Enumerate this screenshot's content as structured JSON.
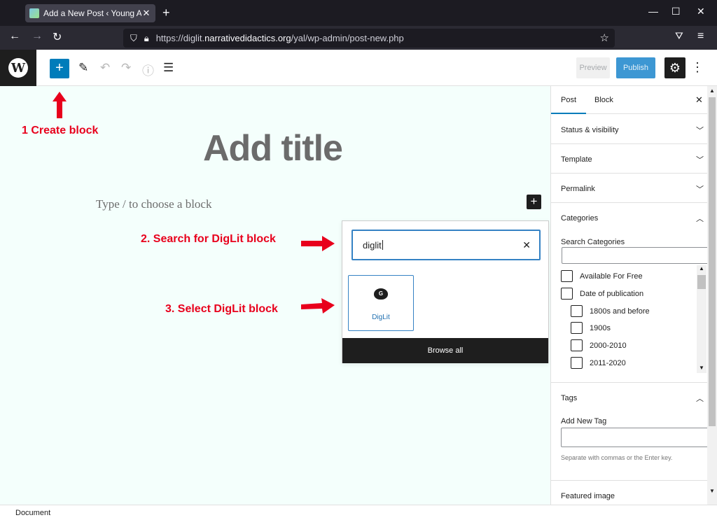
{
  "browser": {
    "tab_title": "Add a New Post ‹ Young Adult L",
    "url_prefix": "https://diglit.",
    "url_host": "narrativedidactics.org",
    "url_path": "/yal/wp-admin/post-new.php"
  },
  "toolbar": {
    "preview_label": "Preview",
    "publish_label": "Publish"
  },
  "annotations": {
    "step1": "1 Create block",
    "step2": "2. Search for DigLit block",
    "step3": "3. Select DigLit block",
    "color": "#e8001c"
  },
  "editor": {
    "title_placeholder": "Add title",
    "block_placeholder": "Type / to choose a block",
    "canvas_bg": "#f4fffc"
  },
  "inserter": {
    "search_value": "diglit",
    "result_label": "DigLit",
    "result_icon_letter": "G",
    "browse_all_label": "Browse all"
  },
  "sidebar": {
    "tabs": [
      "Post",
      "Block"
    ],
    "panels": {
      "status": "Status & visibility",
      "template": "Template",
      "permalink": "Permalink",
      "categories": "Categories",
      "tags": "Tags",
      "featured": "Featured image"
    },
    "search_categories_label": "Search Categories",
    "categories": [
      {
        "name": "Available For Free",
        "level": 0
      },
      {
        "name": "Date of publication",
        "level": 0
      },
      {
        "name": "1800s and before",
        "level": 1
      },
      {
        "name": "1900s",
        "level": 1
      },
      {
        "name": "2000-2010",
        "level": 1
      },
      {
        "name": "2011-2020",
        "level": 1
      }
    ],
    "add_tag_label": "Add New Tag",
    "tags_hint": "Separate with commas or the Enter key."
  },
  "status_bar": {
    "label": "Document"
  },
  "colors": {
    "accent": "#007cba",
    "publish": "#3d97d3",
    "dark": "#1e1e1e"
  }
}
